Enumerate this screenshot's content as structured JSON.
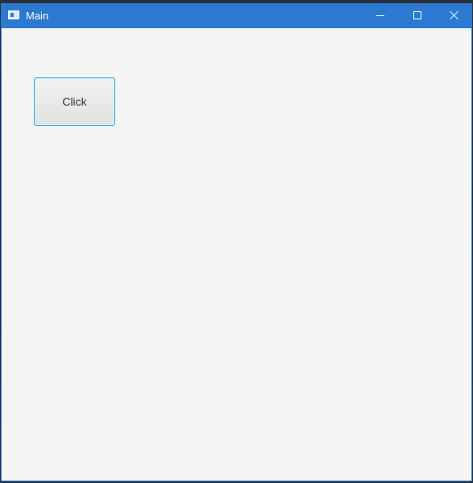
{
  "window": {
    "title": "Main",
    "titlebar_color": "#2b79d0",
    "background_color": "#f4f4f4",
    "controls": {
      "minimize_icon": "minimize-icon",
      "maximize_icon": "maximize-icon",
      "close_icon": "close-icon"
    },
    "app_icon": "app-window-icon"
  },
  "main": {
    "button_label": "Click",
    "button_border_color": "#1ea6e8"
  }
}
